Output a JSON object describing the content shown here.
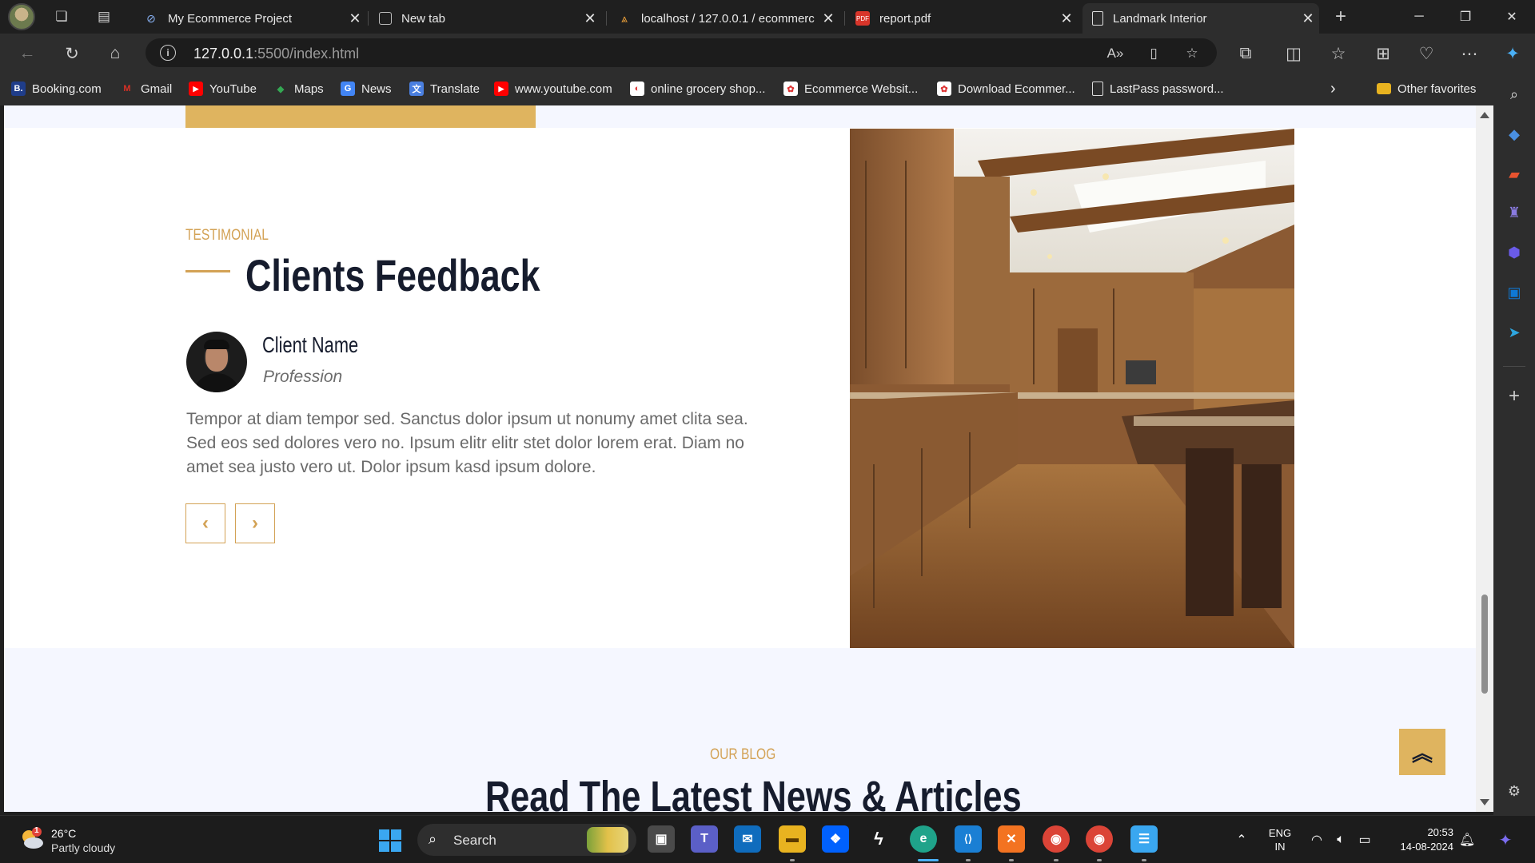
{
  "browser": {
    "tabs": [
      {
        "title": "My Ecommerce Project",
        "icon": "link-icon",
        "active": false
      },
      {
        "title": "New tab",
        "icon": "newtab-icon",
        "active": false
      },
      {
        "title": "localhost / 127.0.0.1 / ecommerc",
        "icon": "phpmyadmin-icon",
        "active": false
      },
      {
        "title": "report.pdf",
        "icon": "pdf-icon",
        "active": false
      },
      {
        "title": "Landmark Interior",
        "icon": "document-icon",
        "active": true
      }
    ],
    "address": {
      "host": "127.0.0.1",
      "path": ":5500/index.html"
    },
    "favorites": [
      {
        "label": "Booking.com",
        "icon": "booking-icon",
        "color": "#1f3d8a",
        "glyph": "B."
      },
      {
        "label": "Gmail",
        "icon": "gmail-icon",
        "color": "#d93025",
        "glyph": "M"
      },
      {
        "label": "YouTube",
        "icon": "youtube-icon",
        "color": "#ff0000",
        "glyph": "▶"
      },
      {
        "label": "Maps",
        "icon": "maps-icon",
        "color": "#34a853",
        "glyph": "◆"
      },
      {
        "label": "News",
        "icon": "news-icon",
        "color": "#4285f4",
        "glyph": "G"
      },
      {
        "label": "Translate",
        "icon": "translate-icon",
        "color": "#4a7fe0",
        "glyph": "文"
      },
      {
        "label": "www.youtube.com",
        "icon": "youtube-icon",
        "color": "#ff0000",
        "glyph": "▶"
      },
      {
        "label": "online grocery shop...",
        "icon": "site-icon",
        "color": "#ffffff",
        "glyph": "◐"
      },
      {
        "label": "Ecommerce Websit...",
        "icon": "site-icon",
        "color": "#ffffff",
        "glyph": "✿"
      },
      {
        "label": "Download Ecommer...",
        "icon": "site-icon",
        "color": "#ffffff",
        "glyph": "✿"
      },
      {
        "label": "LastPass password...",
        "icon": "document-icon",
        "color": "#2d2d2d",
        "glyph": "▯"
      }
    ],
    "other_favorites": "Other favorites"
  },
  "page": {
    "testimonial": {
      "subtitle": "Testimonial",
      "title": "Clients Feedback",
      "client_name": "Client Name",
      "profession": "Profession",
      "quote": "Tempor at diam tempor sed. Sanctus dolor ipsum ut nonumy amet clita sea. Sed eos sed dolores vero no. Ipsum elitr elitr stet dolor lorem erat. Diam no amet sea justo vero ut. Dolor ipsum kasd ipsum dolore."
    },
    "blog": {
      "subtitle": "Our Blog",
      "title": "Read The Latest News & Articles"
    },
    "accent": "#dfb45f"
  },
  "taskbar": {
    "weather": {
      "temp": "26°C",
      "condition": "Partly cloudy",
      "badge": "1"
    },
    "search_label": "Search",
    "apps": [
      {
        "name": "task-view-icon",
        "color": "#4a4a4a",
        "glyph": "▣"
      },
      {
        "name": "teams-icon",
        "color": "#5b5fc7",
        "glyph": "T"
      },
      {
        "name": "mail-icon",
        "color": "#0f6cbd",
        "glyph": "✉"
      },
      {
        "name": "file-explorer-icon",
        "color": "#e8b320",
        "glyph": "▬"
      },
      {
        "name": "dropbox-icon",
        "color": "#0061fe",
        "glyph": "❖"
      },
      {
        "name": "app-icon",
        "color": "#1c1c1c",
        "glyph": "ϟ"
      },
      {
        "name": "edge-icon",
        "color": "#1fa38a",
        "glyph": "e"
      },
      {
        "name": "vscode-icon",
        "color": "#1a7fd4",
        "glyph": "⟨⟩"
      },
      {
        "name": "xampp-icon",
        "color": "#f37321",
        "glyph": "✕"
      },
      {
        "name": "chrome-icon",
        "color": "#db4437",
        "glyph": "◉"
      },
      {
        "name": "chrome-icon",
        "color": "#db4437",
        "glyph": "◉"
      },
      {
        "name": "notepad-icon",
        "color": "#3aa7f0",
        "glyph": "☰"
      }
    ],
    "lang_top": "ENG",
    "lang_bottom": "IN",
    "time": "20:53",
    "date": "14-08-2024"
  }
}
